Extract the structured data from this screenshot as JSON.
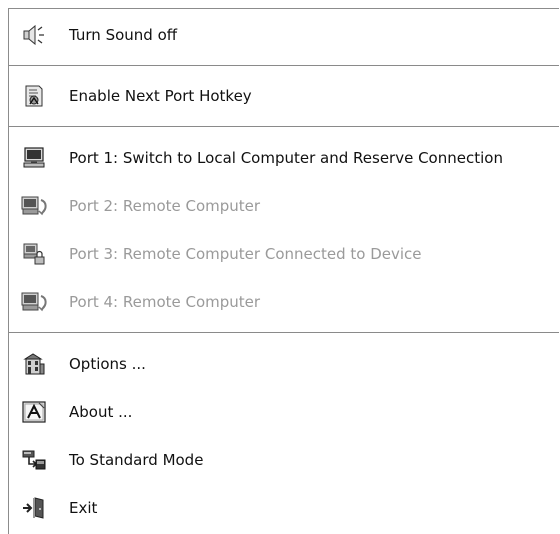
{
  "menu": {
    "items": [
      {
        "label": "Turn Sound off",
        "icon": "speaker-icon",
        "enabled": true
      },
      {
        "label": "Enable Next Port Hotkey",
        "icon": "hotkey-icon",
        "enabled": true
      },
      {
        "label": "Port 1: Switch to Local Computer and Reserve Connection",
        "icon": "local-computer-icon",
        "enabled": true
      },
      {
        "label": "Port 2: Remote Computer",
        "icon": "remote-computer-icon",
        "enabled": false
      },
      {
        "label": "Port 3: Remote Computer Connected to Device",
        "icon": "remote-locked-icon",
        "enabled": false
      },
      {
        "label": "Port 4: Remote Computer",
        "icon": "remote-computer-icon",
        "enabled": false
      },
      {
        "label": "Options ...",
        "icon": "options-icon",
        "enabled": true
      },
      {
        "label": "About ...",
        "icon": "about-icon",
        "enabled": true
      },
      {
        "label": "To Standard Mode",
        "icon": "standard-mode-icon",
        "enabled": true
      },
      {
        "label": "Exit",
        "icon": "exit-icon",
        "enabled": true
      }
    ]
  }
}
